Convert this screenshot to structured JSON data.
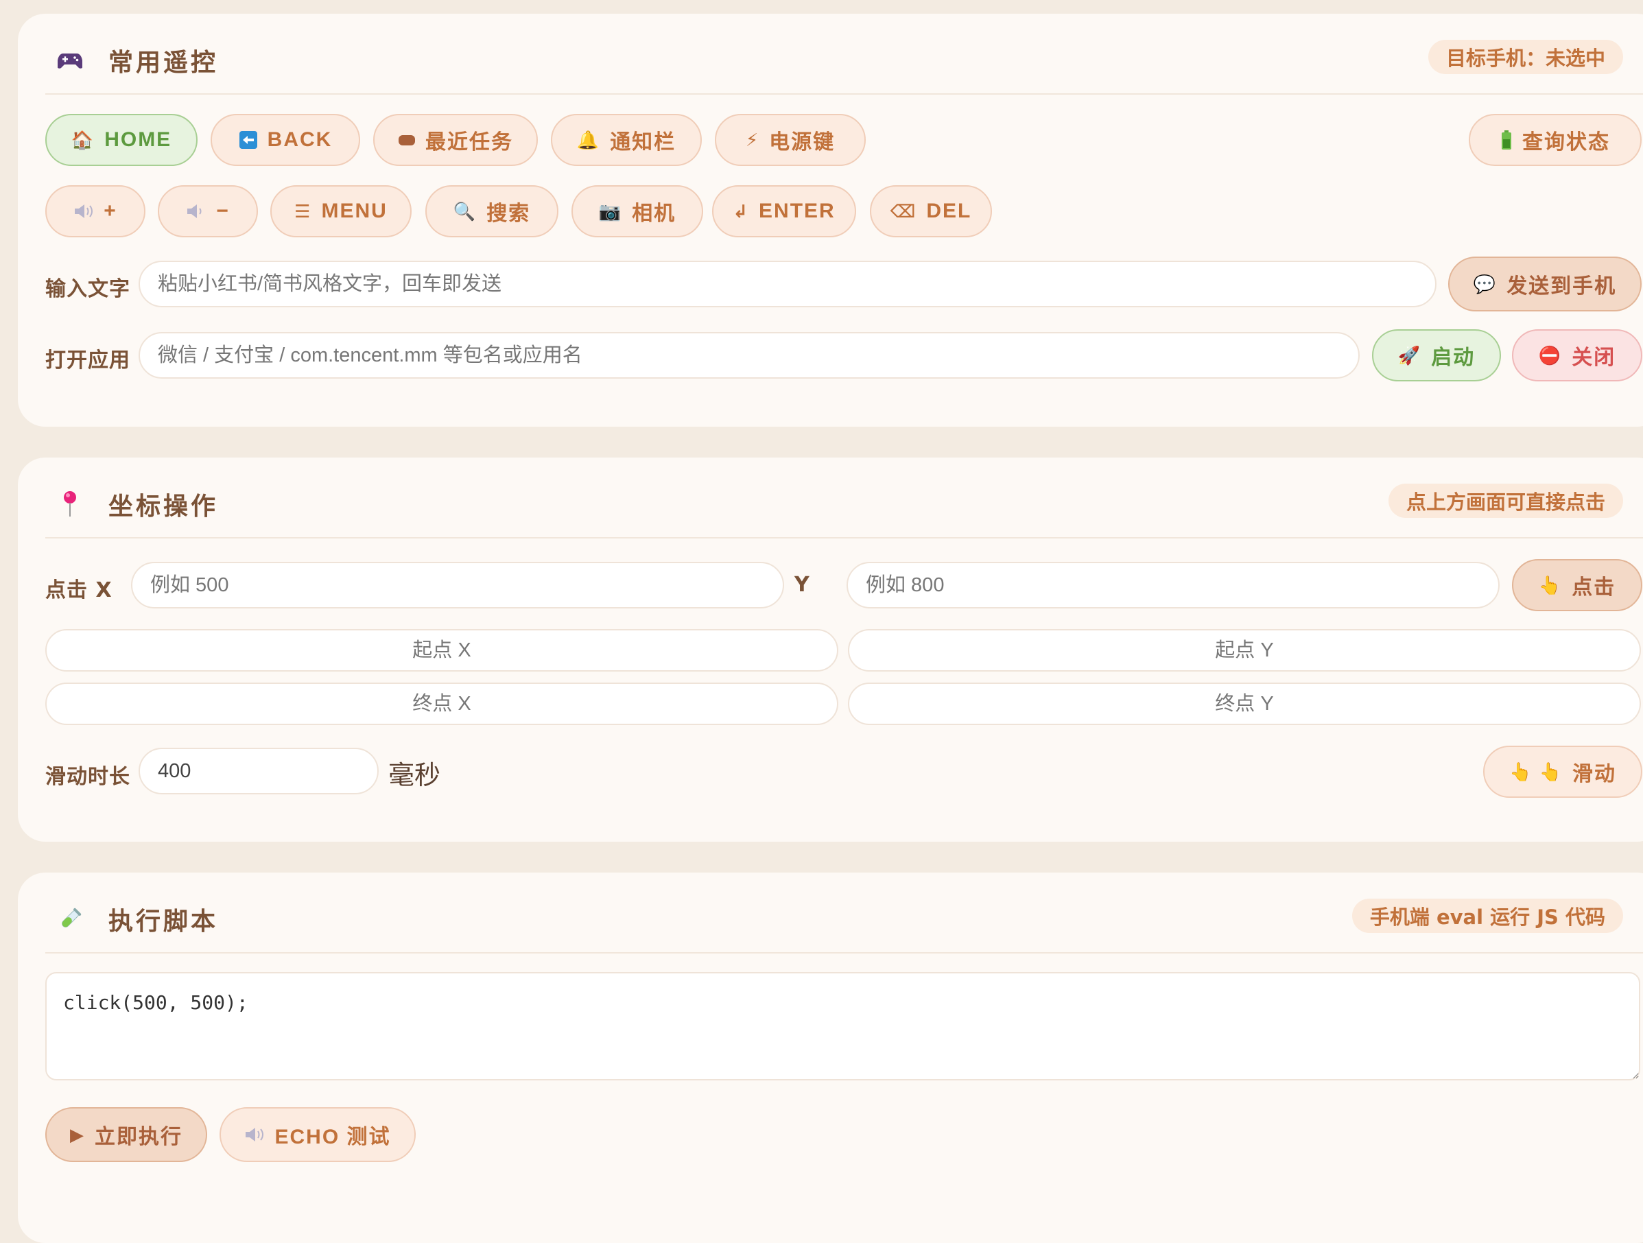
{
  "remote": {
    "title": "常用遥控",
    "icon": "gamepad-icon",
    "badge": "目标手机：未选中",
    "buttons_row1": [
      {
        "key": "home",
        "icon": "🏠",
        "label": "HOME"
      },
      {
        "key": "back",
        "icon": "⬅",
        "label": "BACK"
      },
      {
        "key": "recent",
        "icon": "▬",
        "label": "最近任务"
      },
      {
        "key": "notify",
        "icon": "🔔",
        "label": "通知栏"
      },
      {
        "key": "power",
        "icon": "⚡",
        "label": "电源键"
      },
      {
        "key": "status",
        "icon": "🔋",
        "label": "查询状态"
      }
    ],
    "buttons_row2": [
      {
        "key": "volup",
        "icon": "🔈",
        "label": "+"
      },
      {
        "key": "voldown",
        "icon": "🔈",
        "label": "−"
      },
      {
        "key": "menu",
        "icon": "☰",
        "label": "MENU"
      },
      {
        "key": "search",
        "icon": "🔍",
        "label": "搜索"
      },
      {
        "key": "camera",
        "icon": "📷",
        "label": "相机"
      },
      {
        "key": "enter",
        "icon": "↲",
        "label": "ENTER"
      },
      {
        "key": "del",
        "icon": "⌫",
        "label": "DEL"
      }
    ],
    "text_label": "输入文字",
    "text_placeholder": "粘贴小红书/简书风格文字，回车即发送",
    "send_icon": "💬",
    "send_label": "发送到手机",
    "app_label": "打开应用",
    "app_placeholder": "微信 / 支付宝 / com.tencent.mm 等包名或应用名",
    "launch_icon": "🚀",
    "launch_label": "启动",
    "close_icon": "⛔",
    "close_label": "关闭"
  },
  "coords": {
    "title": "坐标操作",
    "icon": "pin-icon",
    "badge": "点上方画面可直接点击",
    "click_label": "点击 X",
    "x_placeholder": "例如 500",
    "y_label": "Y",
    "y_placeholder": "例如 800",
    "click_icon": "👆",
    "click_button": "点击",
    "start_x_placeholder": "起点 X",
    "start_y_placeholder": "起点 Y",
    "end_x_placeholder": "终点 X",
    "end_y_placeholder": "终点 Y",
    "duration_label": "滑动时长",
    "duration_value": "400",
    "duration_unit": "毫秒",
    "swipe_icon": "👆 👆",
    "swipe_button": "滑动"
  },
  "script": {
    "title": "执行脚本",
    "icon": "test-tube-icon",
    "badge": "手机端 eval 运行 JS 代码",
    "code": "click(500, 500);",
    "run_icon": "▶",
    "run_label": "立即执行",
    "echo_icon": "🔈",
    "echo_label": "ECHO 测试"
  }
}
